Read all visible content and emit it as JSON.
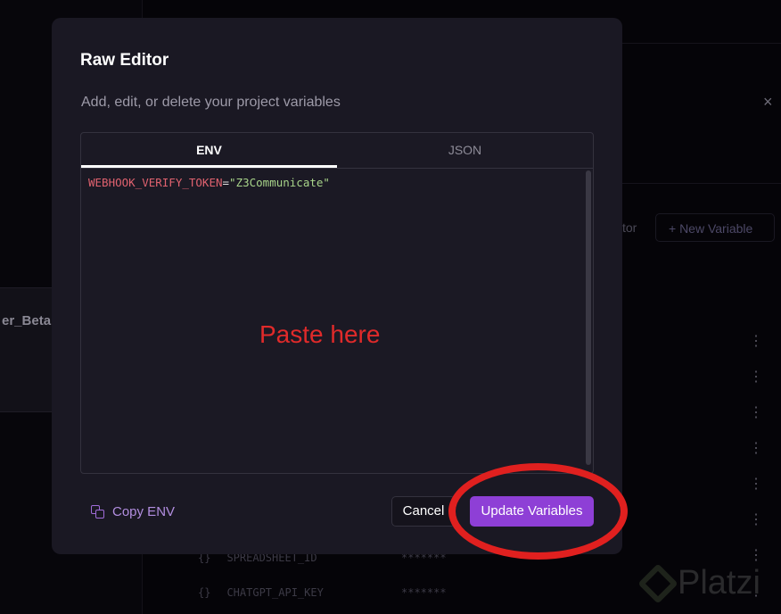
{
  "background": {
    "project_name_partial": "er_Beta",
    "raw_editor_partial": "tor",
    "new_variable": "+ New Variable",
    "close": "×",
    "rows": [
      {
        "icon": "{}",
        "key": "SPREADSHEET_ID",
        "value": "*******"
      },
      {
        "icon": "{}",
        "key": "CHATGPT_API_KEY",
        "value": "*******"
      }
    ],
    "watermark": "Platzi"
  },
  "modal": {
    "title": "Raw Editor",
    "subtitle": "Add, edit, or delete your project variables",
    "tabs": [
      {
        "label": "ENV",
        "active": true
      },
      {
        "label": "JSON",
        "active": false
      }
    ],
    "code": {
      "key": "WEBHOOK_VERIFY_TOKEN",
      "eq": "=",
      "value": "\"Z3Communicate\""
    },
    "annotation": "Paste here",
    "copy_label": "Copy ENV",
    "cancel_label": "Cancel",
    "update_label": "Update Variables"
  },
  "colors": {
    "accent": "#8e3fd6",
    "annotation": "#e0201f"
  }
}
